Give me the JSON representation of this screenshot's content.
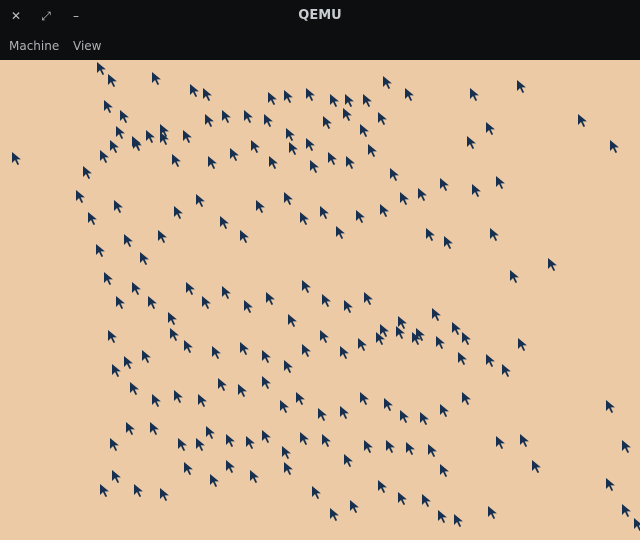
{
  "window": {
    "title": "QEMU",
    "controls": {
      "close_glyph": "✕",
      "maximize_glyph": "⤢",
      "minimize_glyph": "–"
    }
  },
  "menubar": {
    "items": [
      "Machine",
      "View"
    ]
  },
  "display": {
    "background_color": "#edcaa6",
    "cursor_color": "#17304f",
    "cursor_icon": "mouse-pointer-icon"
  }
}
